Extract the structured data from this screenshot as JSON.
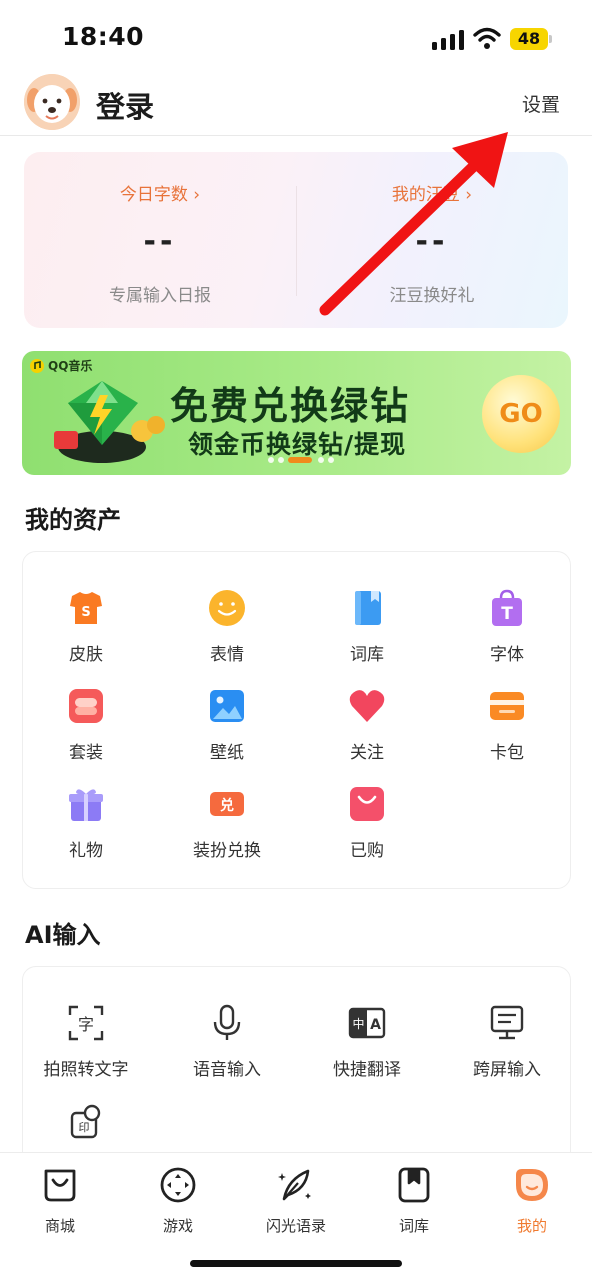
{
  "status_bar": {
    "time": "18:40",
    "battery": "48"
  },
  "header": {
    "login_label": "登录",
    "settings_label": "设置"
  },
  "stats": {
    "left": {
      "title": "今日字数 ›",
      "value": "--",
      "sub": "专属输入日报"
    },
    "right": {
      "title": "我的汪豆 ›",
      "value": "--",
      "sub": "汪豆换好礼"
    }
  },
  "banner": {
    "brand": "QQ音乐",
    "title": "免费兑换绿钻",
    "subtitle": "领金币换绿钻/提现",
    "go_label": "GO",
    "colors": {
      "background": "#9fe47f",
      "text": "#123a18",
      "go": "#ef8c18"
    }
  },
  "assets": {
    "title": "我的资产",
    "items": [
      {
        "label": "皮肤",
        "icon": "tshirt-icon"
      },
      {
        "label": "表情",
        "icon": "smiley-icon"
      },
      {
        "label": "词库",
        "icon": "book-icon"
      },
      {
        "label": "字体",
        "icon": "font-bag-icon"
      },
      {
        "label": "套装",
        "icon": "suit-icon"
      },
      {
        "label": "壁纸",
        "icon": "wallpaper-icon"
      },
      {
        "label": "关注",
        "icon": "heart-icon"
      },
      {
        "label": "卡包",
        "icon": "card-wallet-icon"
      },
      {
        "label": "礼物",
        "icon": "gift-icon"
      },
      {
        "label": "装扮兑换",
        "icon": "exchange-icon"
      },
      {
        "label": "已购",
        "icon": "shopping-bag-icon"
      }
    ]
  },
  "ai_input": {
    "title": "AI输入",
    "items": [
      {
        "label": "拍照转文字",
        "icon": "photo-text-icon"
      },
      {
        "label": "语音输入",
        "icon": "microphone-icon"
      },
      {
        "label": "快捷翻译",
        "icon": "translate-icon"
      },
      {
        "label": "跨屏输入",
        "icon": "cross-screen-icon"
      },
      {
        "label": "",
        "icon": "text-convert-icon"
      }
    ]
  },
  "bottom_nav": {
    "items": [
      {
        "label": "商城",
        "icon": "shop-bag-icon",
        "active": false
      },
      {
        "label": "游戏",
        "icon": "gamepad-icon",
        "active": false
      },
      {
        "label": "闪光语录",
        "icon": "feather-icon",
        "active": false
      },
      {
        "label": "词库",
        "icon": "bookmark-book-icon",
        "active": false
      },
      {
        "label": "我的",
        "icon": "profile-icon",
        "active": true
      }
    ]
  },
  "colors": {
    "accent": "#f07a2f",
    "annotation_arrow": "#f01414"
  }
}
